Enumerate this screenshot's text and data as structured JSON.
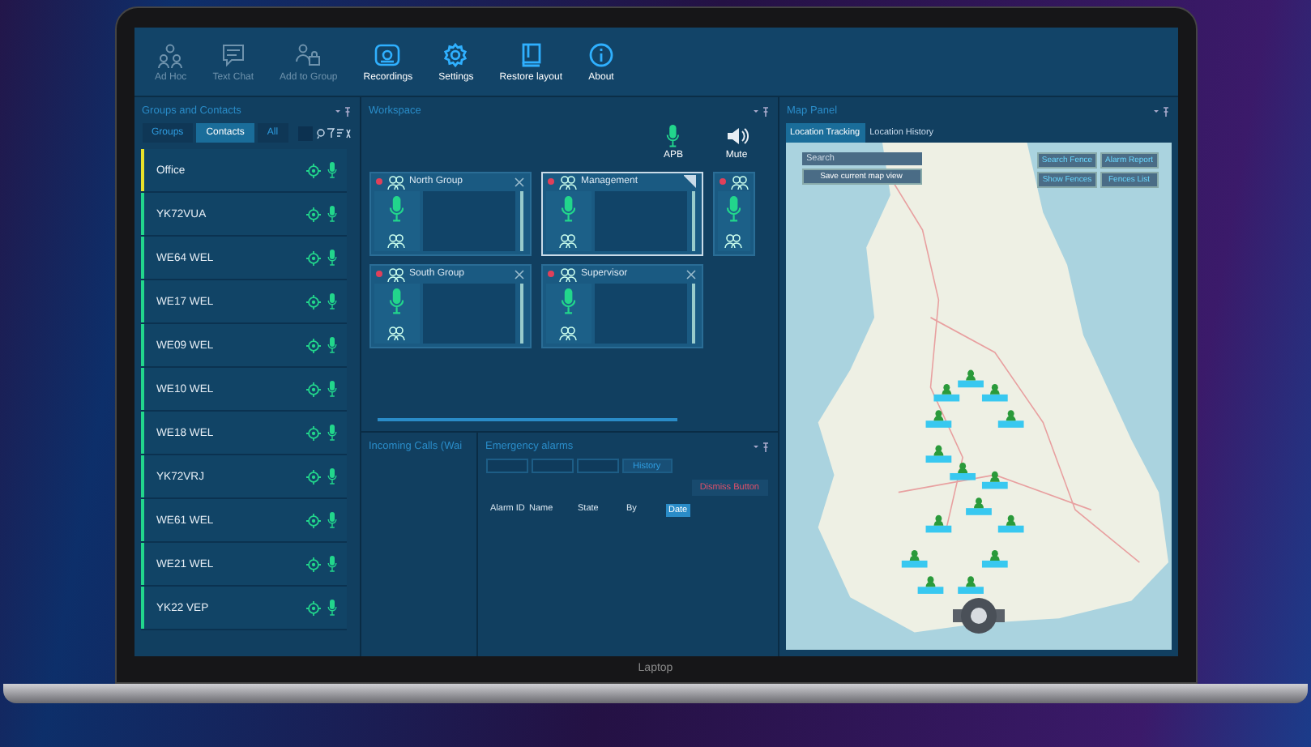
{
  "toolbar": [
    {
      "label": "Ad Hoc",
      "disabled": true
    },
    {
      "label": "Text Chat",
      "disabled": true
    },
    {
      "label": "Add to Group",
      "disabled": true
    },
    {
      "label": "Recordings",
      "disabled": false
    },
    {
      "label": "Settings",
      "disabled": false
    },
    {
      "label": "Restore layout",
      "disabled": false
    },
    {
      "label": "About",
      "disabled": false
    }
  ],
  "contacts_panel": {
    "title": "Groups and Contacts",
    "tabs": [
      {
        "label": "Groups",
        "selected": false
      },
      {
        "label": "Contacts",
        "selected": true
      },
      {
        "label": "All",
        "selected": false
      }
    ],
    "items": [
      {
        "name": "Office",
        "color": "#e8e22a"
      },
      {
        "name": "YK72VUA",
        "color": "#22d68c"
      },
      {
        "name": "WE64 WEL",
        "color": "#22d68c"
      },
      {
        "name": "WE17 WEL",
        "color": "#22d68c"
      },
      {
        "name": "WE09 WEL",
        "color": "#22d68c"
      },
      {
        "name": "WE10 WEL",
        "color": "#22d68c"
      },
      {
        "name": "WE18 WEL",
        "color": "#22d68c"
      },
      {
        "name": "YK72VRJ",
        "color": "#22d68c"
      },
      {
        "name": "WE61 WEL",
        "color": "#22d68c"
      },
      {
        "name": "WE21 WEL",
        "color": "#22d68c"
      },
      {
        "name": "YK22 VEP",
        "color": "#22d68c"
      }
    ]
  },
  "workspace": {
    "title": "Workspace",
    "controls": [
      {
        "kind": "mic",
        "label": "APB"
      },
      {
        "kind": "speaker",
        "label": "Mute"
      }
    ],
    "groups": [
      {
        "name": "North Group",
        "selected": false
      },
      {
        "name": "Management",
        "selected": true
      },
      {
        "name": "South Group",
        "selected": false
      },
      {
        "name": "Supervisor",
        "selected": false
      }
    ]
  },
  "incoming_calls": {
    "title": "Incoming Calls (Wai"
  },
  "emergency_alarms": {
    "title": "Emergency alarms",
    "tabs": [
      {
        "selected": false
      },
      {
        "selected": false
      },
      {
        "selected": false
      },
      {
        "label": "History",
        "selected": true
      }
    ],
    "dismiss_button": "Dismiss Button",
    "columns": [
      "Alarm ID",
      "Name",
      "State",
      "By",
      "Date"
    ]
  },
  "map_panel": {
    "title": "Map Panel",
    "tabs": [
      {
        "label": "Location Tracking",
        "selected": true
      },
      {
        "label": "Location History",
        "selected": false
      }
    ],
    "search": {
      "placeholder": "Search"
    },
    "save_button": "Save current map view",
    "buttons": [
      "Search Fence",
      "Alarm Report",
      "Show Fences",
      "Fences List"
    ]
  },
  "laptop": {
    "label": "Laptop"
  }
}
